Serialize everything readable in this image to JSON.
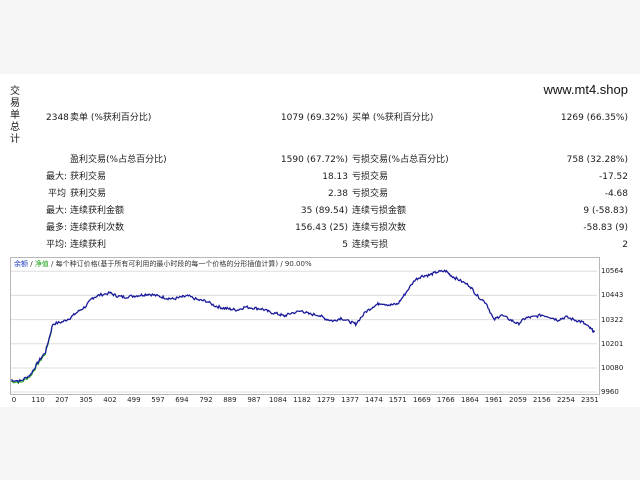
{
  "watermark": "www.mt4.shop",
  "side_label": "交\n易\n单\n总\n计",
  "stats": {
    "total_trades": "2348",
    "short_label": "卖单 (%获利百分比)",
    "short_value": "1079 (69.32%)",
    "long_label": "买单 (%获利百分比)",
    "long_value": "1269 (66.35%)",
    "profit_label": "盈利交易(%占总百分比)",
    "profit_value": "1590 (67.72%)",
    "loss_label": "亏损交易(%占总百分比)",
    "loss_value": "758 (32.28%)",
    "largest_prefix": "最大:",
    "largest_profit_label": "获利交易",
    "largest_profit_value": "18.13",
    "largest_loss_label": "亏损交易",
    "largest_loss_value": "-17.52",
    "average_prefix": "平均",
    "average_profit_label": "获利交易",
    "average_profit_value": "2.38",
    "average_loss_label": "亏损交易",
    "average_loss_value": "-4.68",
    "max_prefix": "最大:",
    "consec_wins_money_label": "连续获利金额",
    "consec_wins_money_value": "35 (89.54)",
    "consec_losses_money_label": "连续亏损金额",
    "consec_losses_money_value": "9 (-58.83)",
    "most_prefix": "最多:",
    "consec_profit_count_label": "连续获利次数",
    "consec_profit_count_value": "156.43 (25)",
    "consec_loss_count_label": "连续亏损次数",
    "consec_loss_count_value": "-58.83 (9)",
    "avg_prefix": "平均:",
    "avg_consec_wins_label": "连续获利",
    "avg_consec_wins_value": "5",
    "avg_consec_losses_label": "连续亏损",
    "avg_consec_losses_value": "2"
  },
  "legend": {
    "balance": "余额",
    "sep1": " / ",
    "equity": "净值",
    "sep2": " / ",
    "note": "每个种订价格(基于所有可利用的最小时段的每一个价格的分形插值计算)",
    "sep3": " / ",
    "quality": "90.00%"
  },
  "colors": {
    "balance_line": "#1a1a9a",
    "equity_line": "#18a018",
    "grid": "#dddddd"
  },
  "chart_data": {
    "type": "line",
    "x_ticks": [
      "0",
      "110",
      "207",
      "305",
      "402",
      "499",
      "597",
      "694",
      "792",
      "889",
      "987",
      "1084",
      "1182",
      "1279",
      "1377",
      "1474",
      "1571",
      "1669",
      "1766",
      "1864",
      "1961",
      "2059",
      "2156",
      "2254",
      "2351"
    ],
    "y_ticks": [
      "10564",
      "10443",
      "10322",
      "10201",
      "10080",
      "9960"
    ],
    "xlim": [
      0,
      2380
    ],
    "ylim": [
      9960,
      10600
    ],
    "series": [
      {
        "x": [
          0,
          40,
          80,
          110,
          140,
          170,
          207,
          240,
          270,
          305,
          330,
          360,
          402,
          430,
          460,
          499,
          530,
          560,
          597,
          630,
          660,
          694,
          720,
          760,
          792,
          830,
          860,
          889,
          920,
          950,
          987,
          1020,
          1050,
          1084,
          1110,
          1140,
          1182,
          1210,
          1250,
          1279,
          1310,
          1340,
          1377,
          1400,
          1440,
          1474,
          1500,
          1540,
          1571,
          1600,
          1640,
          1669,
          1700,
          1730,
          1766,
          1790,
          1820,
          1864,
          1890,
          1930,
          1961,
          1990,
          2030,
          2059,
          2090,
          2120,
          2156,
          2190,
          2220,
          2254,
          2290,
          2320,
          2351,
          2370
        ],
        "y": [
          10020,
          10015,
          10048,
          10110,
          10160,
          10300,
          10310,
          10330,
          10360,
          10390,
          10430,
          10445,
          10455,
          10440,
          10435,
          10440,
          10445,
          10450,
          10440,
          10430,
          10425,
          10435,
          10440,
          10420,
          10415,
          10390,
          10380,
          10375,
          10370,
          10385,
          10380,
          10375,
          10360,
          10350,
          10340,
          10355,
          10365,
          10350,
          10345,
          10325,
          10315,
          10330,
          10310,
          10300,
          10360,
          10390,
          10405,
          10395,
          10400,
          10450,
          10520,
          10540,
          10545,
          10560,
          10565,
          10540,
          10520,
          10490,
          10445,
          10405,
          10320,
          10345,
          10320,
          10300,
          10330,
          10335,
          10345,
          10335,
          10320,
          10335,
          10320,
          10310,
          10280,
          10260
        ]
      }
    ]
  }
}
